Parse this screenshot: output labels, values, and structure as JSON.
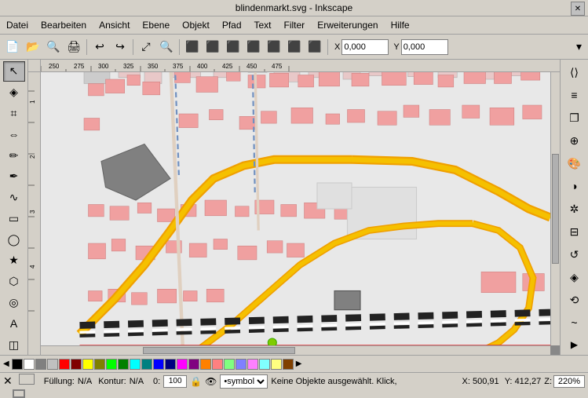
{
  "titlebar": {
    "title": "blindenmarkt.svg - Inkscape",
    "close_label": "✕"
  },
  "menu": {
    "items": [
      "Datei",
      "Bearbeiten",
      "Ansicht",
      "Ebene",
      "Objekt",
      "Pfad",
      "Text",
      "Filter",
      "Erweiterungen",
      "Hilfe"
    ]
  },
  "toolbar": {
    "x_label": "X",
    "y_label": "Y",
    "x_value": "0,000",
    "y_value": "0,000",
    "expand_label": "▾"
  },
  "tools": {
    "left": [
      {
        "name": "selector",
        "icon": "↖",
        "active": true
      },
      {
        "name": "node-editor",
        "icon": "◈"
      },
      {
        "name": "zoom-tool",
        "icon": "⌗"
      },
      {
        "name": "measure",
        "icon": "⇔"
      },
      {
        "name": "pencil",
        "icon": "✏"
      },
      {
        "name": "pen",
        "icon": "✒"
      },
      {
        "name": "calligraphy",
        "icon": "∿"
      },
      {
        "name": "rectangle",
        "icon": "▭"
      },
      {
        "name": "ellipse",
        "icon": "◯"
      },
      {
        "name": "star",
        "icon": "★"
      },
      {
        "name": "3d-box",
        "icon": "⬡"
      },
      {
        "name": "spiral",
        "icon": "◎"
      },
      {
        "name": "text-tool",
        "icon": "A"
      },
      {
        "name": "gradient",
        "icon": "◫"
      }
    ],
    "right": [
      {
        "name": "xml-editor",
        "icon": "⟨⟩"
      },
      {
        "name": "layers",
        "icon": "≡"
      },
      {
        "name": "objects",
        "icon": "❐"
      },
      {
        "name": "symbols",
        "icon": "⊕"
      },
      {
        "name": "swatches",
        "icon": "🎨"
      },
      {
        "name": "fill-stroke",
        "icon": "◑"
      },
      {
        "name": "snap",
        "icon": "✲"
      },
      {
        "name": "align",
        "icon": "⊟"
      },
      {
        "name": "transform",
        "icon": "↺"
      },
      {
        "name": "gradient-editor",
        "icon": "◈"
      },
      {
        "name": "paint-bucket",
        "icon": "⟲"
      },
      {
        "name": "path-effects",
        "icon": "~"
      }
    ]
  },
  "statusbar": {
    "fill_label": "Füllung:",
    "fill_value": "N/A",
    "stroke_label": "Kontur:",
    "stroke_value": "N/A",
    "opacity_value": "0:",
    "opacity_number": "100",
    "symbol_value": "•symbol",
    "status_msg": "Keine Objekte ausgewählt. Klick,",
    "x_label": "X:",
    "x_value": "500,91",
    "y_label": "Y:",
    "y_value": "412,27",
    "zoom_label": "Z:",
    "zoom_value": "220%"
  },
  "palette": {
    "colors": [
      "#000000",
      "#ffffff",
      "#808080",
      "#c0c0c0",
      "#ff0000",
      "#800000",
      "#ffff00",
      "#808000",
      "#00ff00",
      "#008000",
      "#00ffff",
      "#008080",
      "#0000ff",
      "#000080",
      "#ff00ff",
      "#800080",
      "#ff8000",
      "#ff8080",
      "#80ff80",
      "#8080ff",
      "#ff80ff",
      "#80ffff",
      "#ffff80",
      "#804000"
    ]
  },
  "rulers": {
    "top_marks": [
      "250",
      "275",
      "300",
      "325",
      "350",
      "375",
      "400",
      "425",
      "450",
      "475"
    ],
    "left_marks": [
      "1",
      "2",
      "3",
      "4"
    ]
  }
}
